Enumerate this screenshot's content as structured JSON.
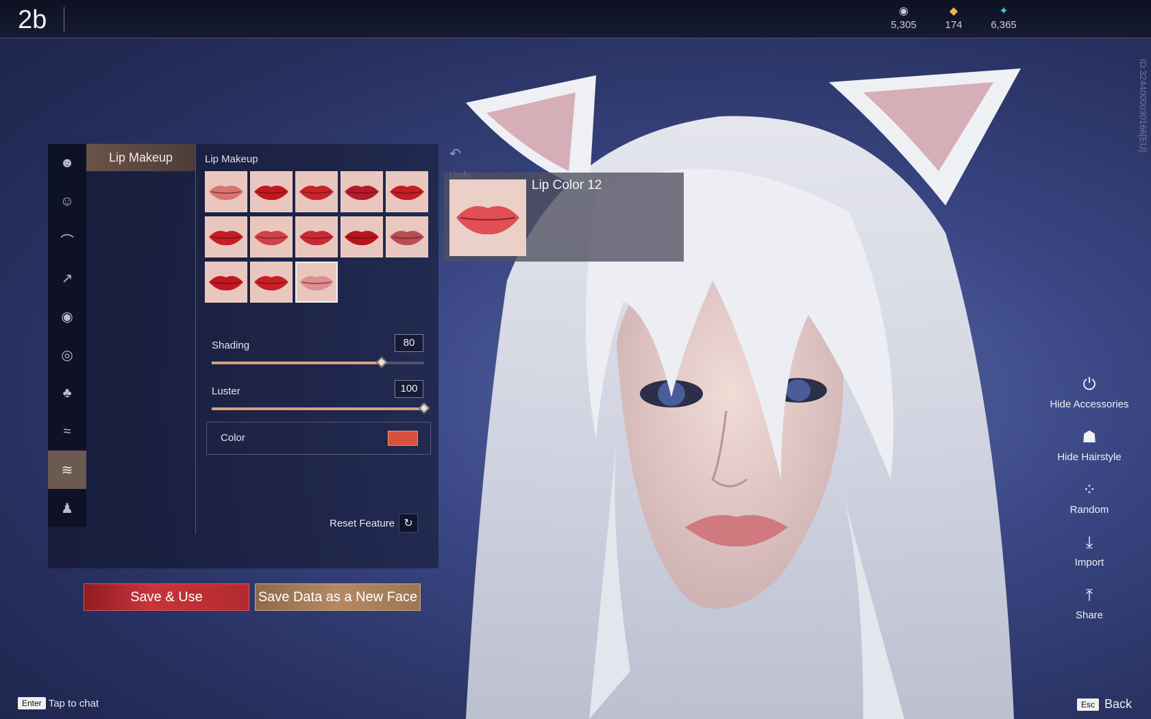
{
  "header": {
    "title": "2b",
    "currencies": [
      {
        "icon": "coin-stack-icon",
        "glyph": "◉",
        "value": "5,305",
        "color": "#c9cbd7"
      },
      {
        "icon": "gold-ticket-icon",
        "glyph": "◆",
        "value": "174",
        "color": "#e7b94b"
      },
      {
        "icon": "feather-gem-icon",
        "glyph": "✦",
        "value": "6,365",
        "color": "#43c6d8"
      }
    ],
    "server_id": "ID:3244000030166[EU]"
  },
  "sidebar": {
    "categories": [
      {
        "name": "face-shape",
        "glyph": "☻"
      },
      {
        "name": "head",
        "glyph": "☺"
      },
      {
        "name": "eyebrow",
        "glyph": "⌒"
      },
      {
        "name": "eyebrow-style",
        "glyph": "↗"
      },
      {
        "name": "eye",
        "glyph": "◉"
      },
      {
        "name": "eye-makeup",
        "glyph": "◎"
      },
      {
        "name": "nose",
        "glyph": "♣"
      },
      {
        "name": "mouth",
        "glyph": "≈"
      },
      {
        "name": "lip-makeup",
        "glyph": "≋",
        "active": true
      },
      {
        "name": "body",
        "glyph": "♟"
      }
    ],
    "sub_item": "Lip Makeup"
  },
  "lip_makeup": {
    "section_label": "Lip Makeup",
    "swatches": [
      {
        "color": "#d9746f"
      },
      {
        "color": "#c0181f"
      },
      {
        "color": "#c6232a"
      },
      {
        "color": "#b31b2a"
      },
      {
        "color": "#c31d27"
      },
      {
        "color": "#c51c25"
      },
      {
        "color": "#d14148"
      },
      {
        "color": "#c82a33"
      },
      {
        "color": "#b5151d"
      },
      {
        "color": "#b84e55"
      },
      {
        "color": "#c11820"
      },
      {
        "color": "#c91e27"
      },
      {
        "color": "#de8f8f",
        "selected": true
      }
    ],
    "shading": {
      "label": "Shading",
      "value": 80
    },
    "luster": {
      "label": "Luster",
      "value": 100
    },
    "color": {
      "label": "Color",
      "value": "#d9503b"
    },
    "reset_label": "Reset Feature"
  },
  "preview": {
    "undo_label": "Undo",
    "name": "Lip Color 12",
    "lip_color": "#e04f55"
  },
  "buttons": {
    "save_use": "Save & Use",
    "save_new_face": "Save Data as a New Face"
  },
  "actions": [
    {
      "name": "hide-accessories",
      "label": "Hide Accessories",
      "glyph": "⏻"
    },
    {
      "name": "hide-hairstyle",
      "label": "Hide Hairstyle",
      "glyph": "☗"
    },
    {
      "name": "random",
      "label": "Random",
      "glyph": "⁘"
    },
    {
      "name": "import",
      "label": "Import",
      "glyph": "⤓"
    },
    {
      "name": "share",
      "label": "Share",
      "glyph": "⤒"
    }
  ],
  "footer": {
    "enter_key": "Enter",
    "chat_hint": "Tap to chat",
    "esc_key": "Esc",
    "back_label": "Back"
  }
}
